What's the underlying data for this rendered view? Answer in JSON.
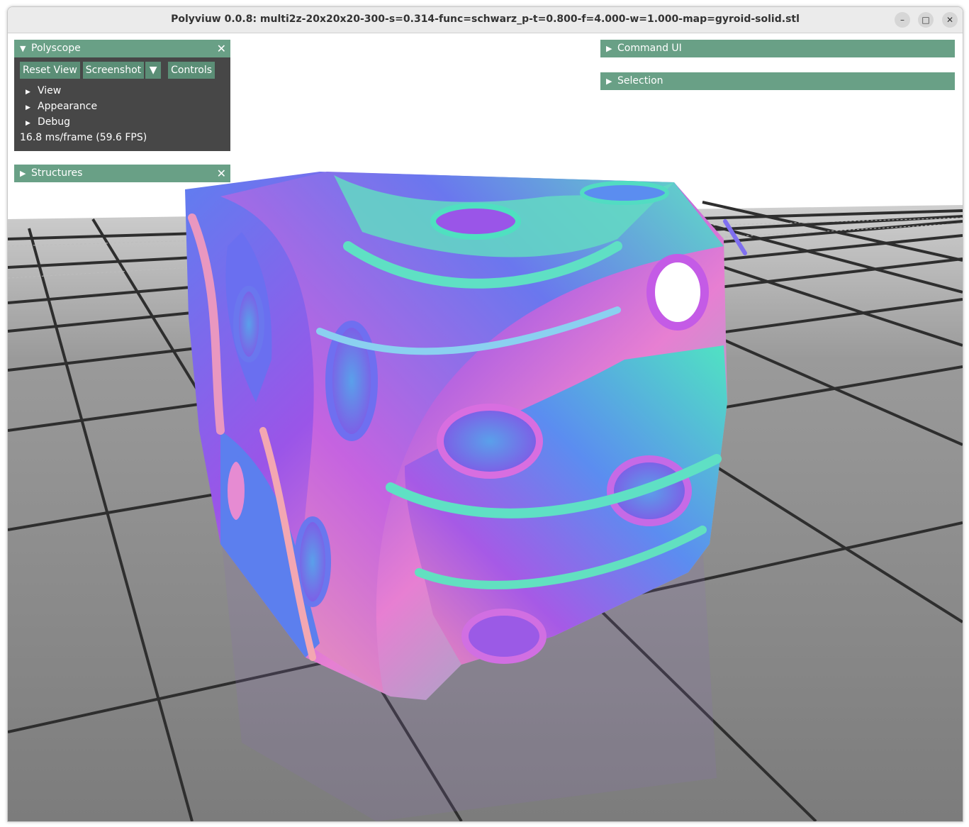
{
  "window": {
    "title": "Polyviuw 0.0.8: multi2z-20x20x20-300-s=0.314-func=schwarz_p-t=0.800-f=4.000-w=1.000-map=gyroid-solid.stl",
    "minimize_icon": "minimize-icon",
    "maximize_icon": "maximize-icon",
    "close_icon": "close-icon"
  },
  "polyscope_panel": {
    "title": "Polyscope",
    "buttons": {
      "reset_view": "Reset View",
      "screenshot": "Screenshot",
      "controls": "Controls"
    },
    "tree": [
      "View",
      "Appearance",
      "Debug"
    ],
    "fps_text": "16.8 ms/frame (59.6 FPS)"
  },
  "structures_panel": {
    "title": "Structures"
  },
  "command_panel": {
    "title": "Command UI"
  },
  "selection_panel": {
    "title": "Selection"
  },
  "colors": {
    "panel_header": "#69a086",
    "panel_body": "#474747",
    "button": "#5b8e76",
    "ground": "#8a8a8a"
  },
  "icons": {
    "expanded_triangle": "triangle-down-icon",
    "collapsed_triangle": "triangle-right-icon",
    "panel_close": "close-x-icon",
    "dropdown": "triangle-down-icon"
  }
}
